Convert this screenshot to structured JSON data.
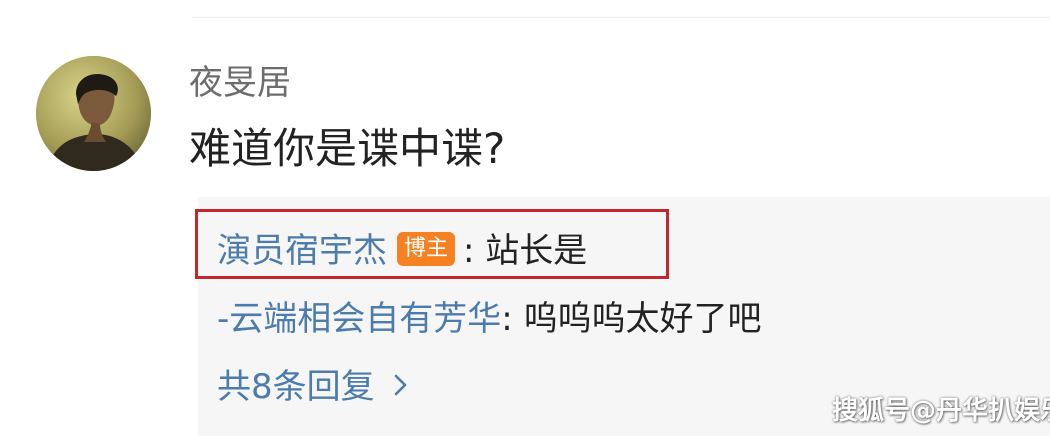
{
  "comment": {
    "username": "夜旻居",
    "text": "难道你是谍中谍?",
    "avatar_icon": "user-avatar-photo"
  },
  "replies": [
    {
      "name": "演员宿宇杰",
      "badge": "博主",
      "sep": ":",
      "text": "站长是"
    },
    {
      "name": "-云端相会自有芳华",
      "sep": ":",
      "text": "呜呜呜太好了吧"
    }
  ],
  "more_replies": {
    "label": "共8条回复",
    "icon": "chevron-right-icon"
  },
  "watermark": "搜狐号@丹华扒娱乐",
  "colors": {
    "link": "#4b7cab",
    "badge": "#f58122",
    "highlight": "#c0282d",
    "reply_bg": "#f6f6f6"
  }
}
